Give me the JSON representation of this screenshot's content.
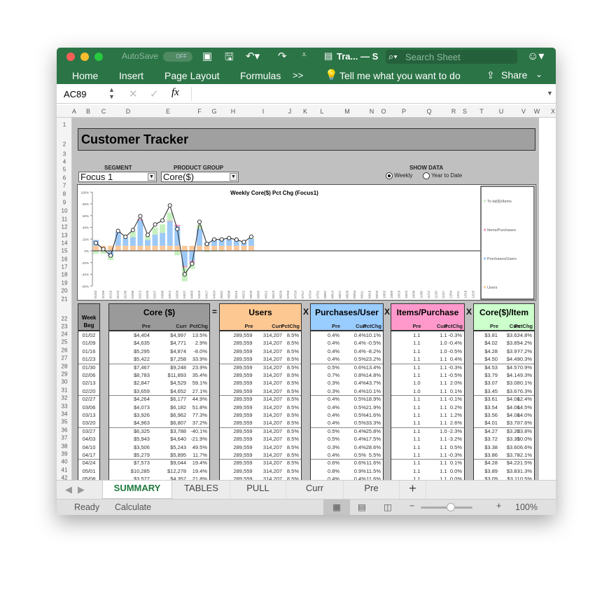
{
  "window": {
    "autosave_label": "AutoSave",
    "autosave_state": "OFF",
    "doc_title": "Tra... — S",
    "search_placeholder": "Search Sheet"
  },
  "ribbon": {
    "tabs": [
      "Home",
      "Insert",
      "Page Layout",
      "Formulas"
    ],
    "more": ">>",
    "tell_me": "Tell me what you want to do",
    "share": "Share"
  },
  "formula_bar": {
    "name_box": "AC89",
    "cancel": "✕",
    "enter": "✓",
    "fx": "fx",
    "value": ""
  },
  "columns": [
    "A",
    "B",
    "C",
    "D",
    "E",
    "F",
    "G",
    "H",
    "I",
    "J",
    "K",
    "L",
    "M",
    "N",
    "O",
    "P",
    "Q",
    "R",
    "S",
    "T",
    "U",
    "V",
    "W",
    "X"
  ],
  "rows": [
    "1",
    "2",
    "3",
    "4",
    "5",
    "6",
    "7",
    "8",
    "9",
    "10",
    "11",
    "12",
    "13",
    "14",
    "15",
    "16",
    "17",
    "18",
    "19",
    "20",
    "21",
    "22",
    "23",
    "24",
    "25",
    "26",
    "27",
    "28",
    "29",
    "30",
    "31",
    "32",
    "33",
    "34",
    "35",
    "36",
    "37",
    "38",
    "39",
    "40",
    "41",
    "42"
  ],
  "sheet": {
    "title": "Customer Tracker",
    "segment_label": "SEGMENT",
    "segment_value": "Focus 1",
    "product_label": "PRODUCT GROUP",
    "product_value": "Core($)",
    "show_data_label": "SHOW DATA",
    "show_options": [
      "Weekly",
      "Year to Date"
    ],
    "show_selected": "Weekly"
  },
  "chart_data": {
    "type": "bar+line",
    "title": "Weekly Core($) Pct Chg (Focus1)",
    "yticks": [
      "100%",
      "80%",
      "60%",
      "40%",
      "20%",
      "0%",
      "-20%",
      "-40%",
      "-60%"
    ],
    "ylim": [
      -60,
      100
    ],
    "categories": [
      "01/02",
      "01/09",
      "01/16",
      "01/23",
      "01/30",
      "02/06",
      "02/13",
      "02/20",
      "02/27",
      "03/06",
      "03/13",
      "03/20",
      "03/27",
      "04/03",
      "04/10",
      "04/17",
      "04/24",
      "05/01",
      "05/08",
      "05/15",
      "05/22",
      "05/29",
      "06/05",
      "06/12",
      "06/19",
      "06/26",
      "07/03",
      "07/10",
      "07/17",
      "07/24",
      "07/31",
      "08/07",
      "08/14",
      "08/21",
      "08/28",
      "09/04",
      "09/11",
      "09/18",
      "09/25",
      "10/02",
      "10/09",
      "10/16",
      "10/23",
      "10/30",
      "11/06",
      "11/13",
      "11/20",
      "11/27",
      "12/04",
      "12/11",
      "12/18",
      "12/25"
    ],
    "line": [
      13.5,
      2.9,
      -8.0,
      33.9,
      23.9,
      35.4,
      59.1,
      27.1,
      44.9,
      51.8,
      77.3,
      37.2,
      -40.1,
      -21.9,
      49.5,
      11.7,
      19.4,
      19.4,
      21.8,
      19,
      15,
      24
    ],
    "series": [
      {
        "name": "Users",
        "color": "#fcc99a",
        "values": [
          8.5,
          8.5,
          8.5,
          8.5,
          8.5,
          8.5,
          8.5,
          8.5,
          8.5,
          8.5,
          8.5,
          8.5,
          8.5,
          8.5,
          8.5,
          8.5,
          8.5,
          8.5,
          8.5,
          8.5,
          8.5,
          8.5
        ]
      },
      {
        "name": "Purchases/Users",
        "color": "#9dc9f7",
        "values": [
          10.1,
          -0.5,
          -8.2,
          23.2,
          13.4,
          14.8,
          43.7,
          10.1,
          18.9,
          21.9,
          41.6,
          33.3,
          -25.8,
          -17.5,
          28.6,
          5.5,
          11.6,
          11.5,
          11.6,
          10,
          7,
          12
        ]
      },
      {
        "name": "Items/Purchases",
        "color": "#f59ac6",
        "values": [
          -0.3,
          -0.4,
          -0.5,
          0.4,
          -0.3,
          -0.5,
          2.0,
          0.1,
          -0.1,
          0.2,
          1.2,
          2.6,
          -2.3,
          -3.2,
          0.5,
          -0.3,
          0.1,
          0.0,
          0.0,
          0,
          0,
          0
        ]
      },
      {
        "name": "Total($)/Items",
        "color": "#c6f0c0",
        "values": [
          -4.8,
          -4.2,
          -7.2,
          -0.3,
          0.9,
          9.3,
          0.1,
          6.3,
          12.4,
          14.5,
          14.0,
          -7.6,
          -23.8,
          -10.0,
          6.6,
          -2.1,
          -1.5,
          -1.3,
          0.5,
          0,
          -1,
          2
        ]
      }
    ],
    "legend": [
      "To tal($)/Items",
      "Items/Purchases",
      "Purchases/Users",
      "Users"
    ],
    "legend_placement": "right"
  },
  "table": {
    "week_header": "Week Beg",
    "groups": [
      {
        "title": "Core ($)",
        "color": "#9a9a9a"
      },
      {
        "title": "Users",
        "color": "#fdc892"
      },
      {
        "title": "Purchases/User",
        "color": "#99ccff"
      },
      {
        "title": "Items/Purchase",
        "color": "#ff99cc"
      },
      {
        "title": "Core($)/Item",
        "color": "#ccffcc"
      }
    ],
    "operators": [
      "=",
      "X",
      "X",
      "X"
    ],
    "subheaders": [
      "Pre",
      "Curr",
      "PctChg"
    ],
    "rows": [
      [
        "01/02",
        "$4,404",
        "$4,997",
        "13.5%",
        "289,559",
        "314,207",
        "8.5%",
        "0.4%",
        "0.4%",
        "10.1%",
        "1.1",
        "1.1",
        "-0.3%",
        "$3.81",
        "$3.62",
        "-4.8%"
      ],
      [
        "01/09",
        "$4,635",
        "$4,771",
        "2.9%",
        "289,559",
        "314,207",
        "8.5%",
        "0.4%",
        "0.4%",
        "-0.5%",
        "1.1",
        "1.0",
        "-0.4%",
        "$4.02",
        "$3.85",
        "-4.2%"
      ],
      [
        "01/16",
        "$5,295",
        "$4,874",
        "-8.0%",
        "289,559",
        "314,207",
        "8.5%",
        "0.4%",
        "0.4%",
        "-8.2%",
        "1.1",
        "1.0",
        "-0.5%",
        "$4.28",
        "$3.97",
        "-7.2%"
      ],
      [
        "01/23",
        "$5,422",
        "$7,258",
        "33.9%",
        "289,559",
        "314,207",
        "8.5%",
        "0.4%",
        "0.5%",
        "23.2%",
        "1.1",
        "1.1",
        "0.4%",
        "$4.50",
        "$4.49",
        "-0.3%"
      ],
      [
        "01/30",
        "$7,467",
        "$9,248",
        "23.9%",
        "289,559",
        "314,207",
        "8.5%",
        "0.5%",
        "0.6%",
        "13.4%",
        "1.1",
        "1.1",
        "-0.3%",
        "$4.53",
        "$4.57",
        "0.9%"
      ],
      [
        "02/06",
        "$8,783",
        "$11,893",
        "35.4%",
        "289,559",
        "314,207",
        "8.5%",
        "0.7%",
        "0.8%",
        "14.8%",
        "1.1",
        "1.1",
        "-0.5%",
        "$3.79",
        "$4.14",
        "9.3%"
      ],
      [
        "02/13",
        "$2,847",
        "$4,529",
        "59.1%",
        "289,559",
        "314,207",
        "8.5%",
        "0.3%",
        "0.4%",
        "43.7%",
        "1.0",
        "1.1",
        "2.0%",
        "$3.07",
        "$3.08",
        "0.1%"
      ],
      [
        "02/20",
        "$3,659",
        "$4,652",
        "27.1%",
        "289,559",
        "314,207",
        "8.5%",
        "0.3%",
        "0.4%",
        "10.1%",
        "1.0",
        "1.1",
        "0.1%",
        "$3.45",
        "$3.67",
        "6.3%"
      ],
      [
        "02/27",
        "$4,264",
        "$6,177",
        "44.9%",
        "289,559",
        "314,207",
        "8.5%",
        "0.4%",
        "0.5%",
        "18.9%",
        "1.1",
        "1.1",
        "-0.1%",
        "$3.61",
        "$4.06",
        "12.4%"
      ],
      [
        "03/06",
        "$4,073",
        "$6,182",
        "51.8%",
        "289,559",
        "314,207",
        "8.5%",
        "0.4%",
        "0.5%",
        "21.9%",
        "1.1",
        "1.1",
        "0.2%",
        "$3.54",
        "$4.06",
        "14.5%"
      ],
      [
        "03/13",
        "$3,926",
        "$6,962",
        "77.3%",
        "289,559",
        "314,207",
        "8.5%",
        "0.4%",
        "0.5%",
        "41.6%",
        "1.1",
        "1.1",
        "1.2%",
        "$3.56",
        "$4.06",
        "14.0%"
      ],
      [
        "03/20",
        "$4,963",
        "$6,807",
        "37.2%",
        "289,559",
        "314,207",
        "8.5%",
        "0.4%",
        "0.5%",
        "33.3%",
        "1.1",
        "1.1",
        "2.6%",
        "$4.01",
        "$3.70",
        "-7.6%"
      ],
      [
        "03/27",
        "$6,325",
        "$3,788",
        "-40.1%",
        "289,559",
        "314,207",
        "8.5%",
        "0.5%",
        "0.4%",
        "-25.8%",
        "1.1",
        "1.0",
        "-2.3%",
        "$4.27",
        "$3.25",
        "-23.8%"
      ],
      [
        "04/03",
        "$5,943",
        "$4,640",
        "-21.9%",
        "289,559",
        "314,207",
        "8.5%",
        "0.5%",
        "0.4%",
        "-17.5%",
        "1.1",
        "1.1",
        "-3.2%",
        "$3.72",
        "$3.35",
        "-10.0%"
      ],
      [
        "04/10",
        "$3,506",
        "$5,243",
        "49.5%",
        "289,559",
        "314,207",
        "8.5%",
        "0.3%",
        "0.4%",
        "28.6%",
        "1.1",
        "1.1",
        "0.5%",
        "$3.38",
        "$3.60",
        "6.6%"
      ],
      [
        "04/17",
        "$5,279",
        "$5,895",
        "11.7%",
        "289,559",
        "314,207",
        "8.5%",
        "0.4%",
        "0.5%",
        "5.5%",
        "1.1",
        "1.1",
        "-0.3%",
        "$3.86",
        "$3.78",
        "-2.1%"
      ],
      [
        "04/24",
        "$7,573",
        "$9,044",
        "19.4%",
        "289,559",
        "314,207",
        "8.5%",
        "0.6%",
        "0.6%",
        "11.6%",
        "1.1",
        "1.1",
        "0.1%",
        "$4.28",
        "$4.22",
        "-1.5%"
      ],
      [
        "05/01",
        "$10,285",
        "$12,278",
        "19.4%",
        "289,559",
        "314,207",
        "8.5%",
        "0.8%",
        "0.9%",
        "11.5%",
        "1.1",
        "1.1",
        "0.0%",
        "$3.89",
        "$3.83",
        "-1.3%"
      ],
      [
        "05/08",
        "$3,577",
        "$4,357",
        "21.8%",
        "289,559",
        "314,207",
        "8.5%",
        "0.4%",
        "0.4%",
        "11.6%",
        "1.1",
        "1.1",
        "0.0%",
        "$3.09",
        "$3.11",
        "0.5%"
      ]
    ]
  },
  "sheet_tabs": {
    "items": [
      "SUMMARY",
      "TABLES",
      "PULL",
      "Curr",
      "Pre"
    ],
    "active": "SUMMARY",
    "add": "+"
  },
  "status": {
    "ready": "Ready",
    "calculate": "Calculate",
    "zoom": "100%",
    "zoom_level": 0.5
  }
}
